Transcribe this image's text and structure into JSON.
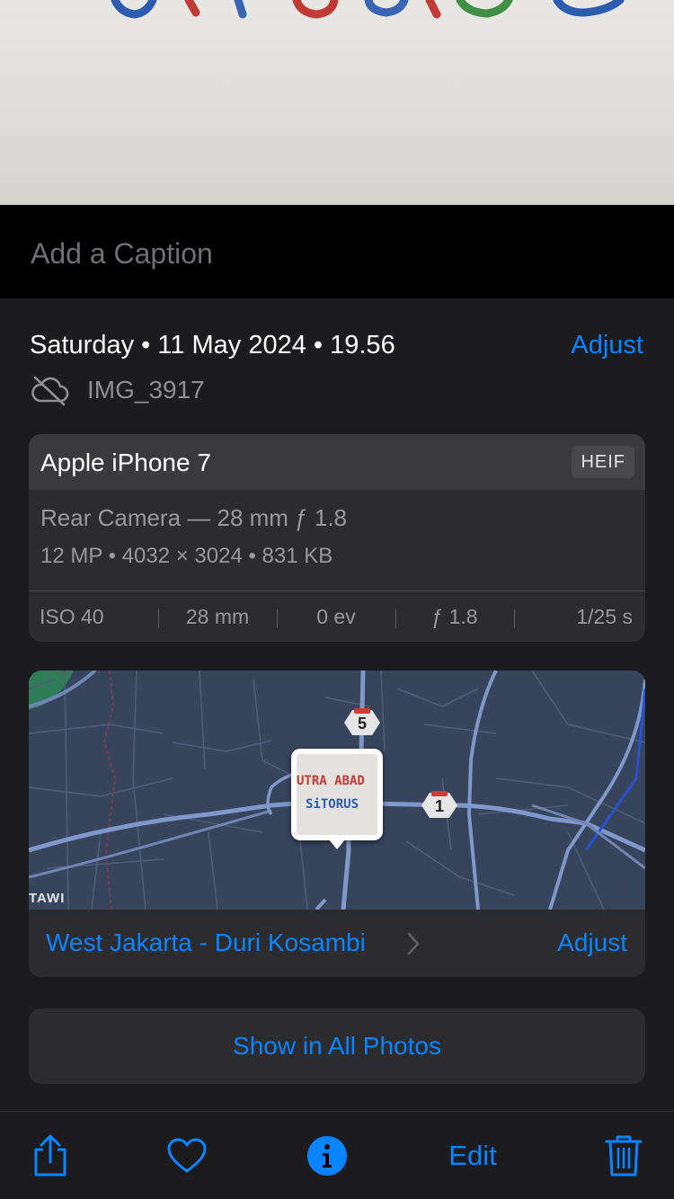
{
  "caption": {
    "placeholder": "Add a Caption"
  },
  "info": {
    "date_time": "Saturday • 11 May 2024 • 19.56",
    "adjust_label": "Adjust",
    "file_name": "IMG_3917",
    "cloud_icon": "cloud-off-icon"
  },
  "camera": {
    "model": "Apple iPhone 7",
    "format_badge": "HEIF",
    "lens": "Rear Camera — 28 mm ƒ 1.8",
    "specs": "12 MP  •  4032 × 3024  •  831 KB",
    "exif": {
      "iso": "ISO 40",
      "focal": "28 mm",
      "ev": "0 ev",
      "aperture": "ƒ 1.8",
      "shutter": "1/25 s"
    }
  },
  "map": {
    "label_tawi": "TAWI",
    "route_5": "5",
    "route_1": "1",
    "thumb_line1": "UTRA ABAD",
    "thumb_line2": "SiTORUS",
    "place": "West Jakarta - Duri Kosambi",
    "adjust_label": "Adjust"
  },
  "show_all_label": "Show in All Photos",
  "toolbar": {
    "share_icon": "share-icon",
    "favorite_icon": "heart-icon",
    "info_icon": "info-icon",
    "edit_label": "Edit",
    "delete_icon": "trash-icon"
  },
  "colors": {
    "accent": "#0a84ff",
    "panel": "#1c1c1e",
    "card": "#2c2c2e",
    "map_bg": "#36445c"
  }
}
